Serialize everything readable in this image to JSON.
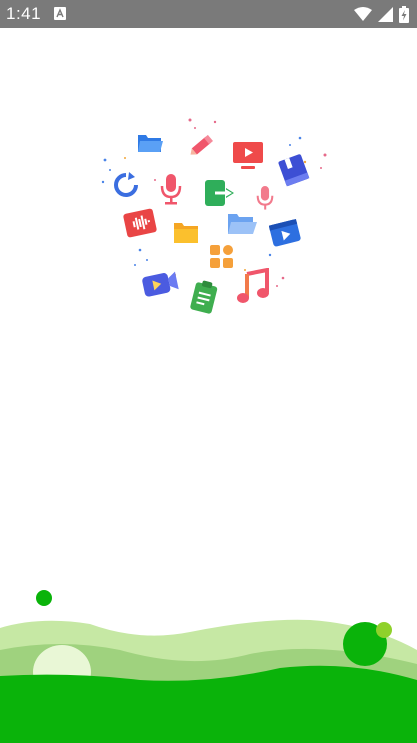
{
  "status_bar": {
    "time": "1:41",
    "notification_icon": "app-notification-icon",
    "icons": [
      "wifi-icon",
      "cell-signal-icon",
      "battery-charging-icon"
    ]
  },
  "splash": {
    "illustration": "app-icons-cluster",
    "icons": [
      "folder-icon",
      "pencil-icon",
      "tv-play-icon",
      "book-icon",
      "refresh-icon",
      "microphone-icon",
      "export-icon",
      "microphone-icon",
      "audio-file-icon",
      "folder-icon",
      "folder-open-icon",
      "video-play-icon",
      "apps-grid-icon",
      "video-camera-icon",
      "note-icon",
      "music-note-icon"
    ],
    "colors": {
      "green_dark": "#0ab30a",
      "green_mid": "#9fd27e",
      "green_light": "#c6e8a4",
      "accent_lime": "#8fd12b"
    }
  }
}
